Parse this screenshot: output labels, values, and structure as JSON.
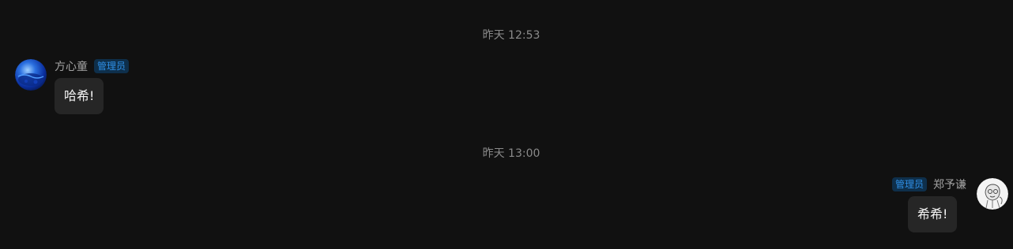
{
  "messages": [
    {
      "time": "昨天 12:53",
      "sender": "方心童",
      "badge": "管理员",
      "text": "哈希!",
      "side": "left",
      "avatar_icon": "blue-globe-avatar"
    },
    {
      "time": "昨天 13:00",
      "sender": "郑予谦",
      "badge": "管理员",
      "text": "希希!",
      "side": "right",
      "avatar_icon": "cartoon-sketch-avatar"
    }
  ],
  "colors": {
    "background": "#111111",
    "bubble": "#262626",
    "badge_text": "#2f8fe6",
    "badge_bg": "#0e2f4b",
    "timestamp": "#8a8a8a",
    "name": "#a3a3a3"
  }
}
